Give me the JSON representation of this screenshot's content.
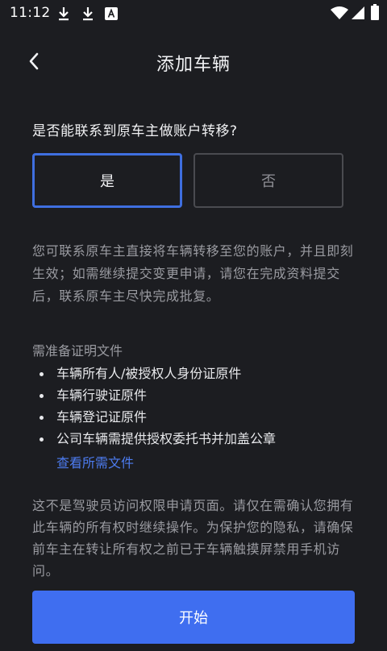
{
  "status_bar": {
    "time": "11:12",
    "icons": [
      "download-icon",
      "download-icon",
      "a-badge-icon",
      "wifi-icon",
      "signal-icon",
      "battery-icon"
    ]
  },
  "header": {
    "title": "添加车辆",
    "back_icon": "chevron-left-icon"
  },
  "question": {
    "text": "是否能联系到原车主做账户转移?",
    "options": [
      {
        "label": "是",
        "selected": true
      },
      {
        "label": "否",
        "selected": false
      }
    ]
  },
  "info": {
    "paragraph": "您可联系原车主直接将车辆转移至您的账户，并且即刻生效；如需继续提交变更申请，请您在完成资料提交后，联系原车主尽快完成批复。"
  },
  "documents": {
    "title": "需准备证明文件",
    "items": [
      "车辆所有人/被授权人身份证原件",
      "车辆行驶证原件",
      "车辆登记证原件",
      "公司车辆需提供授权委托书并加盖公章"
    ],
    "link_label": "查看所需文件"
  },
  "disclaimer": {
    "text": "这不是驾驶员访问权限申请页面。请仅在需确认您拥有此车辆的所有权时继续操作。为保护您的隐私，请确保前车主在转让所有权之前已于车辆触摸屏禁用手机访问。"
  },
  "footer": {
    "start_label": "开始"
  },
  "colors": {
    "background": "#1c1d21",
    "accent": "#3f6ef0",
    "link": "#4d7cf0",
    "muted_text": "#9a9ba1"
  }
}
